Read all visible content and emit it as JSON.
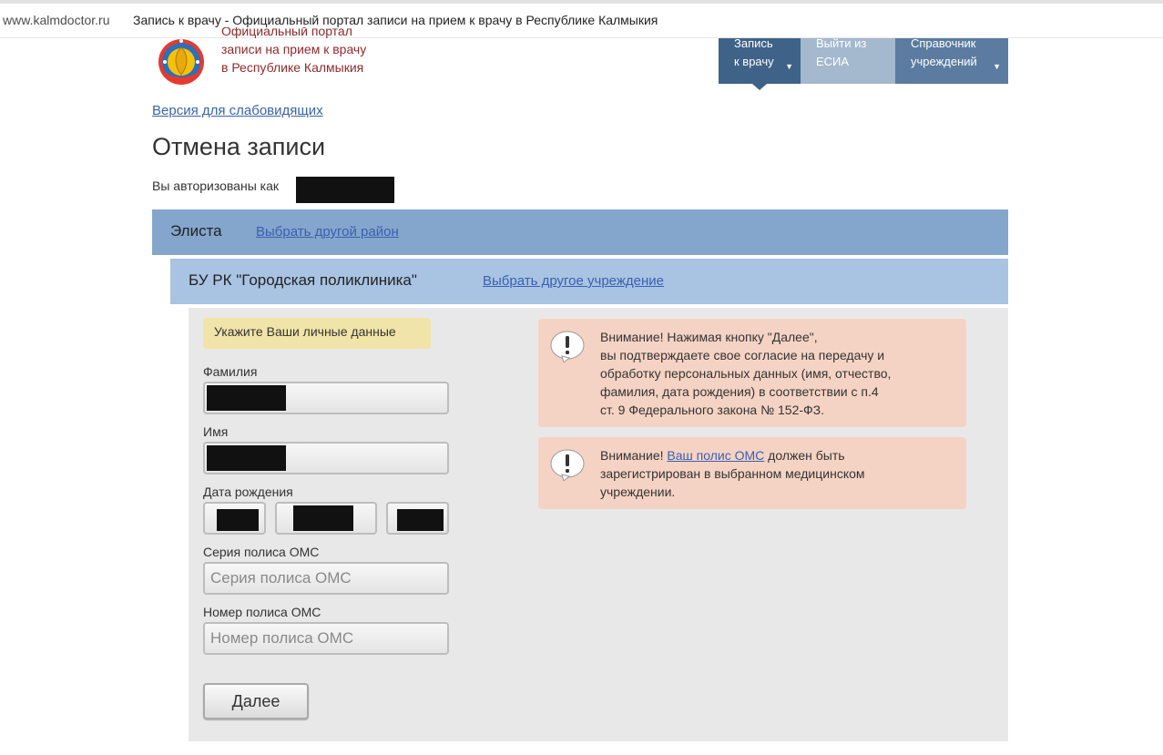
{
  "browser": {
    "url": "www.kalmdoctor.ru",
    "page_title": "Запись к врачу - Официальный портал записи на прием к врачу в Республике Калмыкия"
  },
  "header": {
    "site_title": [
      "Официальный портал",
      "записи на прием к врачу",
      "в Республике Калмыкия"
    ],
    "nav": {
      "appointment": [
        "Запись",
        "к врачу"
      ],
      "esia": [
        "Выйти из",
        "ЕСИА"
      ],
      "directory": [
        "Справочник",
        "учреждений"
      ]
    }
  },
  "accessibility_link": "Версия для слабовидящих",
  "page_heading": "Отмена записи",
  "auth_text": "Вы авторизованы как",
  "district": {
    "name": "Элиста",
    "change_link": "Выбрать другой район"
  },
  "institution": {
    "name": "БУ РК \"Городская поликлиника\"",
    "change_link": "Выбрать другое учреждение"
  },
  "form": {
    "hint": "Укажите Ваши личные данные",
    "surname_label": "Фамилия",
    "name_label": "Имя",
    "birthdate_label": "Дата рождения",
    "policy_series_label": "Серия полиса ОМС",
    "policy_series_placeholder": "Серия полиса ОМС",
    "policy_number_label": "Номер полиса ОМС",
    "policy_number_placeholder": "Номер полиса ОМС",
    "submit_label": "Далее"
  },
  "notices": {
    "consent": {
      "lines": [
        "Внимание! Нажимая кнопку \"Далее\",",
        "вы подтверждаете свое согласие на передачу и",
        "обработку персональных данных (имя, отчество,",
        "фамилия, дата рождения) в соответствии с п.4",
        "ст. 9 Федерального закона № 152-ФЗ."
      ]
    },
    "policy": {
      "prefix": "Внимание!",
      "link": "Ваш полис ОМС",
      "suffix": "должен быть",
      "line2": "зарегистрирован в выбранном медицинском",
      "line3": "учреждении."
    }
  },
  "colors": {
    "nav_active": "#3f6288",
    "district_bar": "#84a6cd",
    "institution_bar": "#a9c3e2",
    "notice_bg": "#f5d3c4",
    "hint_bg": "#f1e4a8"
  },
  "icons": [
    "emblem-logo",
    "caret-down-icon",
    "exclamation-bubble-icon"
  ]
}
